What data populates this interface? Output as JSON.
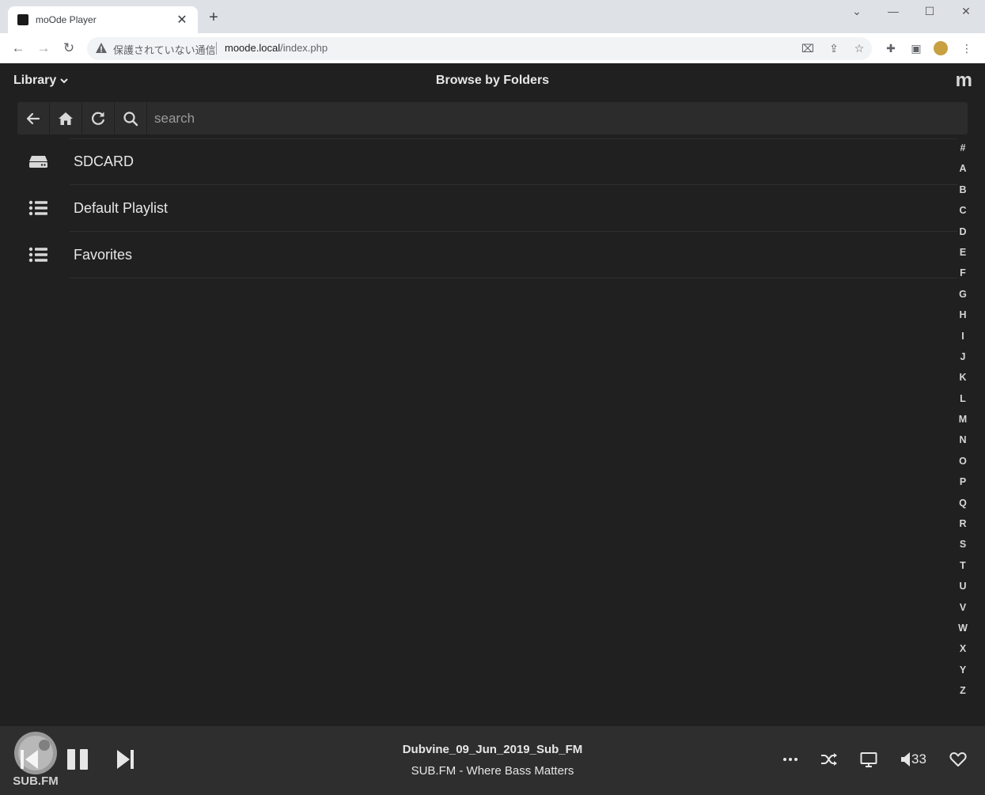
{
  "browser": {
    "tab_title": "moOde Player",
    "security_label": "保護されていない通信",
    "url_host": "moode.local",
    "url_path": "/index.php"
  },
  "header": {
    "library_menu": "Library",
    "title": "Browse by Folders",
    "logo": "m"
  },
  "search": {
    "placeholder": "search"
  },
  "folders": [
    {
      "label": "SDCARD",
      "icon": "hdd-icon"
    },
    {
      "label": "Default Playlist",
      "icon": "list-icon"
    },
    {
      "label": "Favorites",
      "icon": "list-icon"
    }
  ],
  "alphabet": [
    "#",
    "A",
    "B",
    "C",
    "D",
    "E",
    "F",
    "G",
    "H",
    "I",
    "J",
    "K",
    "L",
    "M",
    "N",
    "O",
    "P",
    "Q",
    "R",
    "S",
    "T",
    "U",
    "V",
    "W",
    "X",
    "Y",
    "Z"
  ],
  "player": {
    "cover_text": "SUB.FM",
    "title": "Dubvine_09_Jun_2019_Sub_FM",
    "subtitle": "SUB.FM - Where Bass Matters",
    "volume": "33"
  },
  "colors": {
    "background": "#202020",
    "panel": "#2e2e2e",
    "text": "#e6e6e6"
  }
}
